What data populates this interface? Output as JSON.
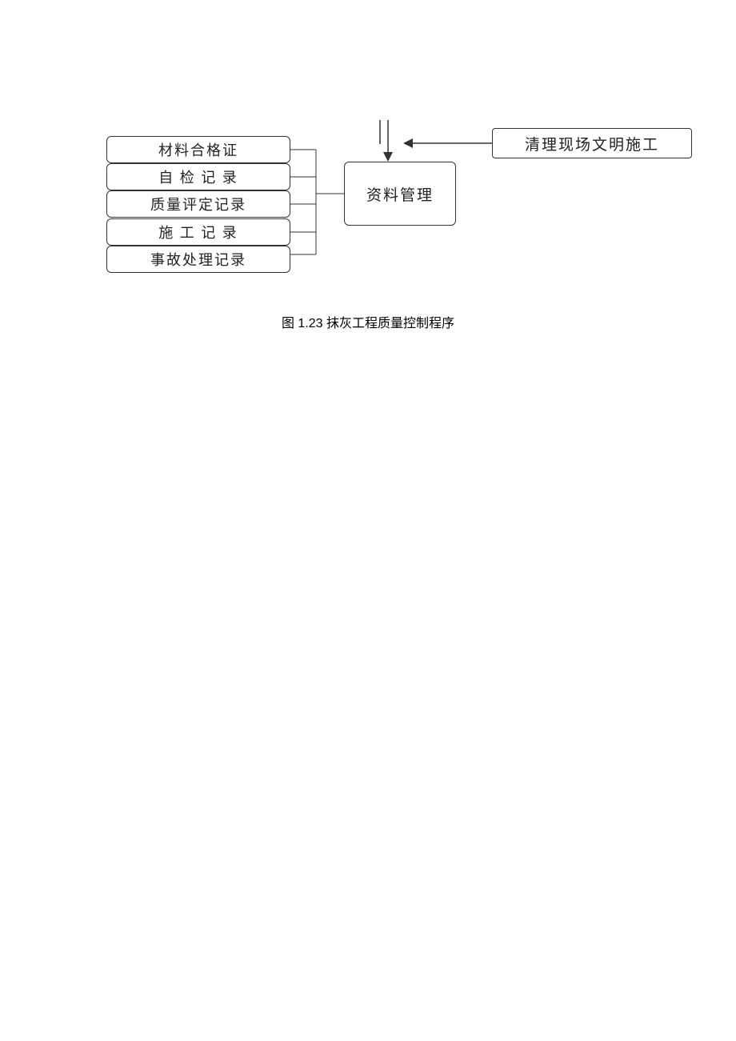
{
  "diagram": {
    "left_items": [
      "材料合格证",
      "自 检 记 录",
      "质量评定记录",
      "施 工 记 录",
      "事故处理记录"
    ],
    "center_box": "资料管理",
    "right_box": "清理现场文明施工",
    "caption": "图 1.23 抹灰工程质量控制程序"
  }
}
